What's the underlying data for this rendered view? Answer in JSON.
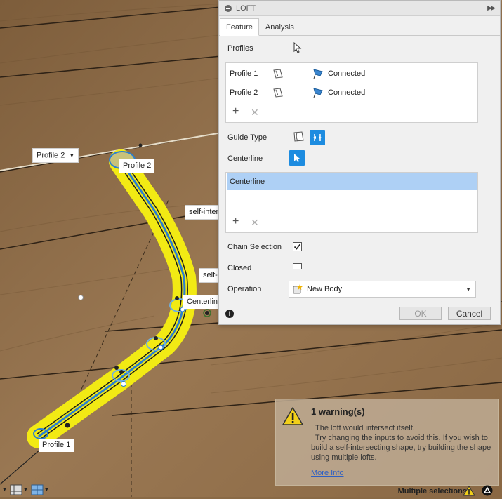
{
  "viewport": {
    "labels": {
      "profile2_dropdown": "Profile 2",
      "profile2_tag": "Profile 2",
      "self_intersection_1": "self-intersection or bad geometry",
      "self_intersection_2": "self-intersection or bad geometry",
      "centerline_tag": "Centerline",
      "profile1_tag": "Profile 1"
    }
  },
  "loft": {
    "title": "LOFT",
    "tabs": [
      "Feature",
      "Analysis"
    ],
    "profiles_label": "Profiles",
    "profiles": [
      {
        "name": "Profile 1",
        "status": "Connected"
      },
      {
        "name": "Profile 2",
        "status": "Connected"
      }
    ],
    "guide_type_label": "Guide Type",
    "centerline_label": "Centerline",
    "centerline_items": [
      "Centerline"
    ],
    "chain_selection_label": "Chain Selection",
    "closed_label": "Closed",
    "operation_label": "Operation",
    "operation_value": "New Body",
    "ok_label": "OK",
    "cancel_label": "Cancel"
  },
  "warning": {
    "title": "1 warning(s)",
    "lines": [
      "The loft would intersect itself.",
      "  Try changing the inputs to avoid this. If you wish to",
      "build a self-intersecting shape, try building the shape",
      "using multiple lofts."
    ],
    "link": "More Info"
  },
  "status": {
    "text": "Multiple selections"
  },
  "colors": {
    "accent": "#1d8ce0",
    "selection": "#aed0f5",
    "path_yellow": "#f2ea14",
    "path_blue": "#2a7fd0",
    "wood": "#8a6a46"
  }
}
